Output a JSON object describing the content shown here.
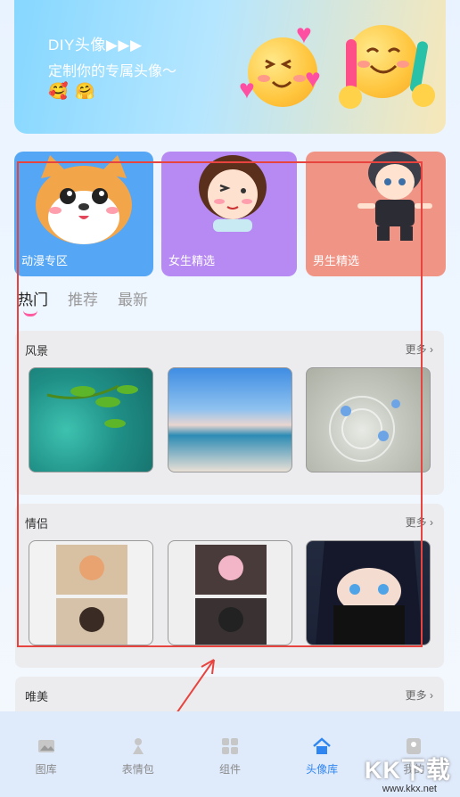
{
  "banner": {
    "title": "DIY头像▶▶▶",
    "subtitle": "定制你的专属头像～",
    "small_emojis": [
      "🥰",
      "🤗"
    ]
  },
  "categories": [
    {
      "label": "动漫专区",
      "color": "#55a6f5"
    },
    {
      "label": "女生精选",
      "color": "#b78af3"
    },
    {
      "label": "男生精选",
      "color": "#f09486"
    }
  ],
  "tabs": [
    {
      "label": "热门",
      "active": true
    },
    {
      "label": "推荐",
      "active": false
    },
    {
      "label": "最新",
      "active": false
    }
  ],
  "sections": [
    {
      "title": "风景",
      "more": "更多"
    },
    {
      "title": "情侣",
      "more": "更多"
    },
    {
      "title": "唯美",
      "more": "更多"
    }
  ],
  "nav": [
    {
      "label": "图库",
      "icon": "image-icon",
      "active": false
    },
    {
      "label": "表情包",
      "icon": "sticker-icon",
      "active": false
    },
    {
      "label": "组件",
      "icon": "widgets-icon",
      "active": false
    },
    {
      "label": "头像库",
      "icon": "home-icon",
      "active": true
    },
    {
      "label": "我的",
      "icon": "profile-icon",
      "active": false
    }
  ],
  "watermark": {
    "logo": "KK下载",
    "url": "www.kkx.net"
  },
  "colors": {
    "accent": "#2f86f0",
    "tab_underline": "#ff5ba0",
    "annotation": "#e8443f"
  }
}
